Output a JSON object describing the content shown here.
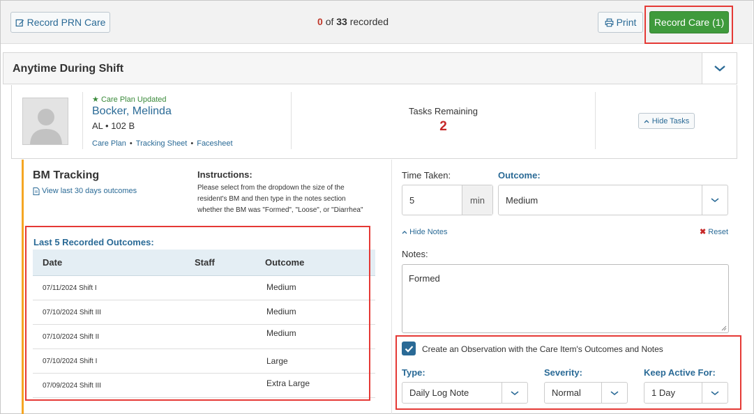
{
  "toolbar": {
    "prn_label": "Record PRN Care",
    "recorded_count": "0",
    "recorded_of": "of",
    "recorded_total": "33",
    "recorded_suffix": "recorded",
    "print_label": "Print",
    "record_care_label": "Record Care (1)"
  },
  "section": {
    "title": "Anytime During Shift"
  },
  "resident": {
    "care_plan_status": "Care Plan Updated",
    "name": "Bocker, Melinda",
    "room": "AL  • 102 B",
    "links": [
      "Care Plan",
      "Tracking Sheet",
      "Facesheet"
    ],
    "tasks_label": "Tasks Remaining",
    "tasks_count": "2",
    "hide_tasks_label": "Hide Tasks"
  },
  "care_item": {
    "title": "BM Tracking",
    "view_last_label": "View last 30 days outcomes",
    "instructions_title": "Instructions:",
    "instructions_text": "Please select from the dropdown the size of the resident's BM and then type in the notes section whether the BM was \"Formed\", \"Loose\", or \"Diarrhea\"",
    "last_outcomes_title": "Last 5 Recorded Outcomes:",
    "table_headers": [
      "Date",
      "Staff",
      "Outcome"
    ],
    "rows": [
      {
        "date": "07/11/2024 Shift I",
        "staff": "",
        "outcome": "Medium"
      },
      {
        "date": "07/10/2024 Shift III",
        "staff": "",
        "outcome": "Medium"
      },
      {
        "date": "07/10/2024 Shift II",
        "staff": "",
        "outcome": "Medium"
      },
      {
        "date": "07/10/2024 Shift I",
        "staff": "",
        "outcome": "Large"
      },
      {
        "date": "07/09/2024 Shift III",
        "staff": "",
        "outcome": "Extra Large"
      }
    ]
  },
  "form": {
    "time_taken_label": "Time Taken:",
    "time_value": "5",
    "time_unit": "min",
    "outcome_label": "Outcome:",
    "outcome_value": "Medium",
    "hide_notes_label": "Hide Notes",
    "reset_label": "Reset",
    "notes_label": "Notes:",
    "notes_value": "Formed",
    "observation_label": "Create an Observation with the Care Item's Outcomes and Notes",
    "observation_checked": true,
    "type_label": "Type:",
    "type_value": "Daily Log Note",
    "severity_label": "Severity:",
    "severity_value": "Normal",
    "keep_active_label": "Keep Active For:",
    "keep_active_value": "1 Day"
  },
  "colors": {
    "accent_blue": "#2a6a96",
    "record_green": "#3f9a3c",
    "alert_red": "#c62828",
    "highlight_box": "#e53935",
    "item_stripe": "#f5a623"
  }
}
